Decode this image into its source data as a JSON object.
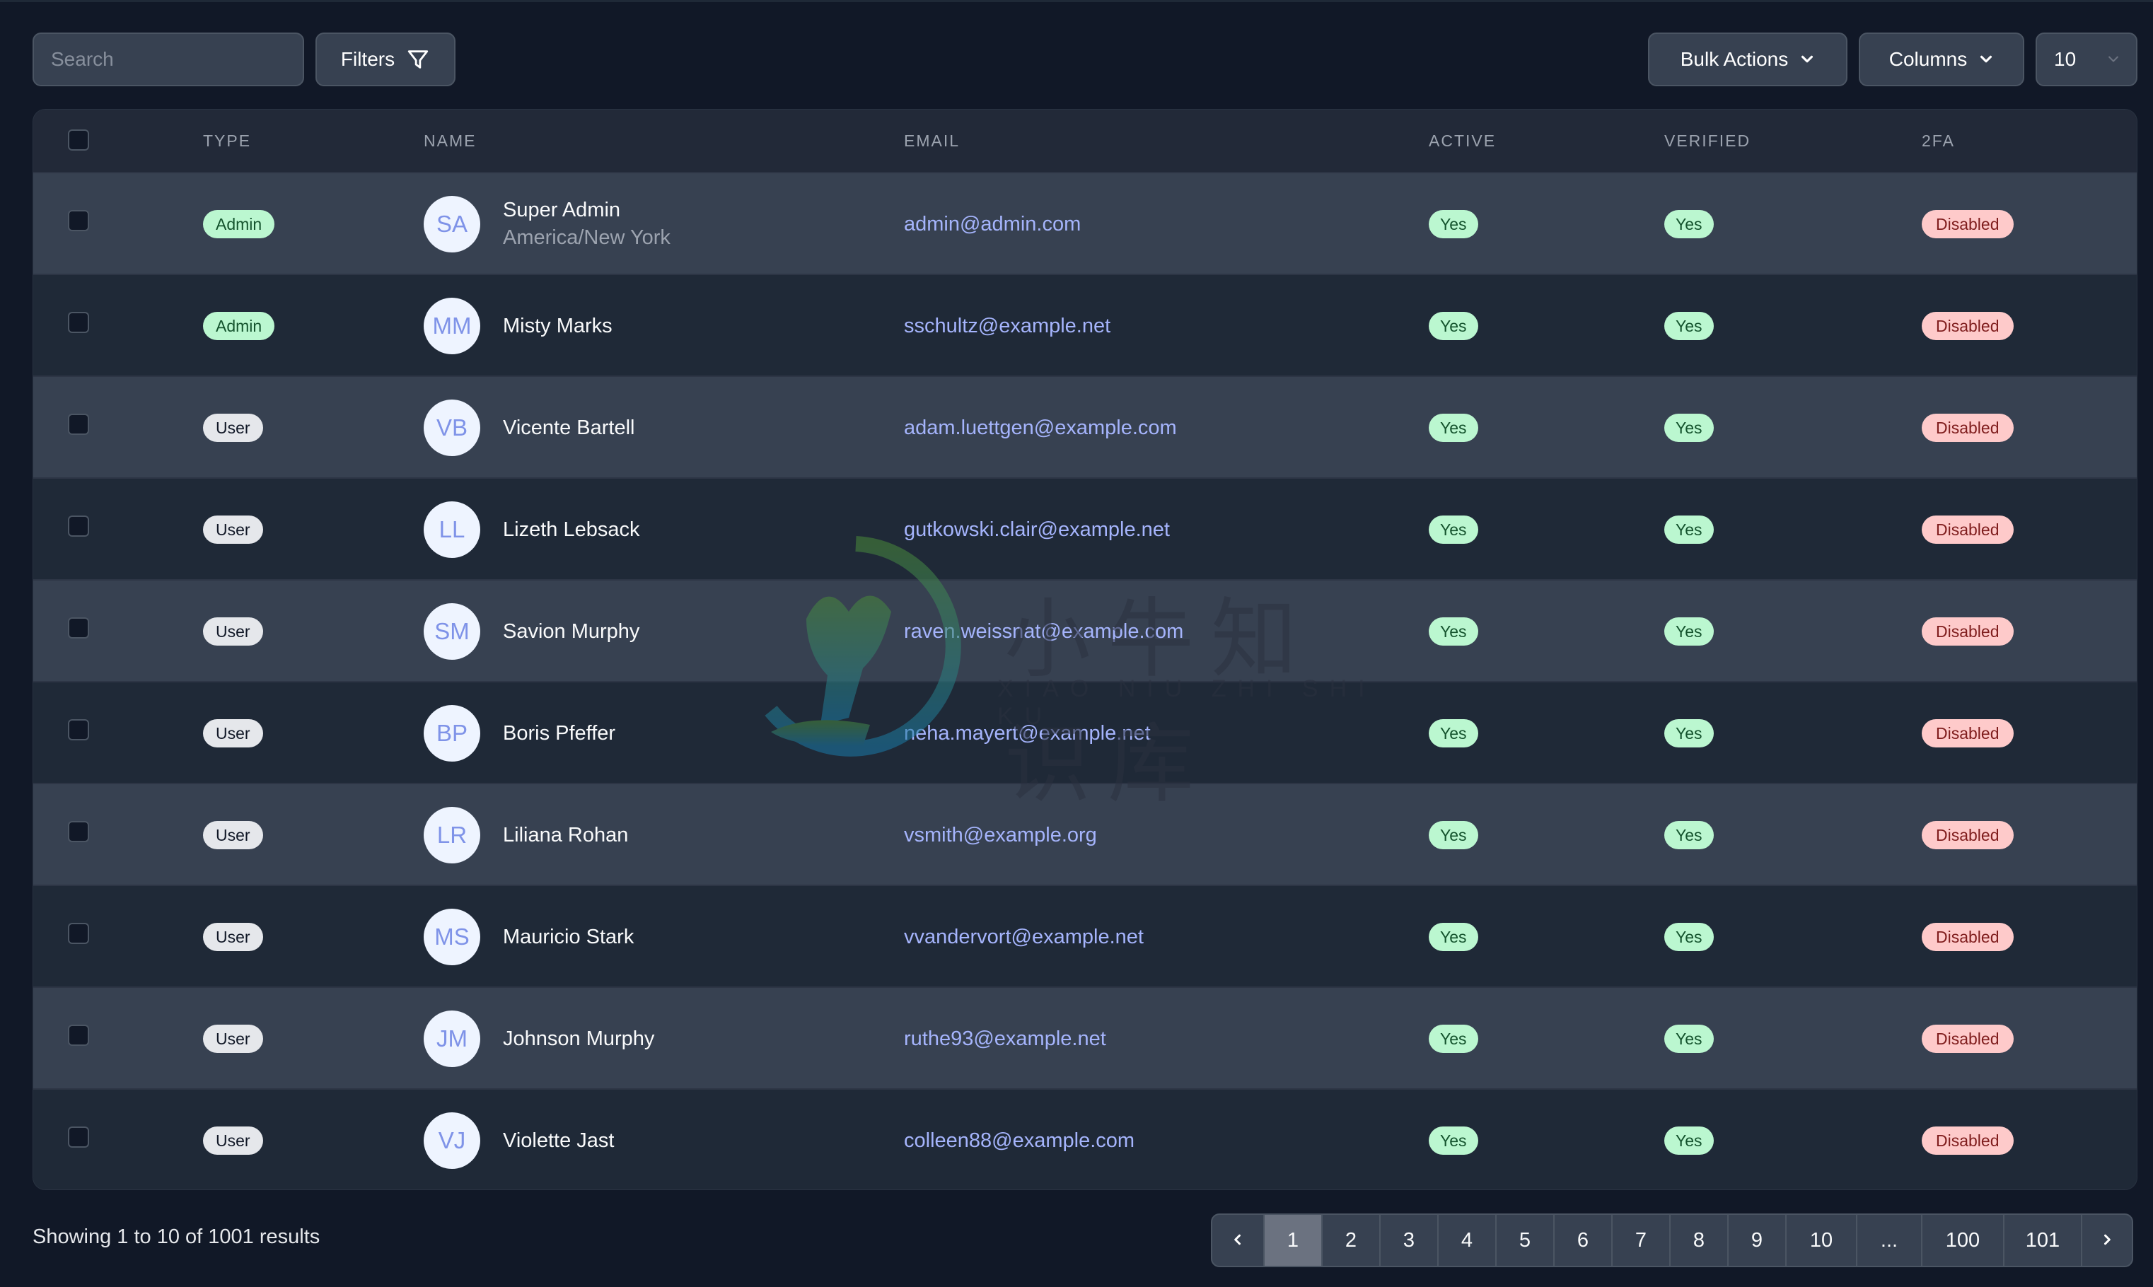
{
  "toolbar": {
    "search_placeholder": "Search",
    "search_value": "",
    "filters_label": "Filters",
    "filters_icon": "funnel-icon",
    "bulk_actions_label": "Bulk Actions",
    "columns_label": "Columns",
    "per_page_value": "10",
    "chevron_icon": "chevron-down-icon"
  },
  "table": {
    "headers": {
      "type": "TYPE",
      "name": "NAME",
      "email": "EMAIL",
      "active": "ACTIVE",
      "verified": "VERIFIED",
      "twofa": "2FA"
    },
    "rows": [
      {
        "type": "Admin",
        "initials": "SA",
        "name": "Super Admin",
        "subtitle": "America/New York",
        "email": "admin@admin.com",
        "active": "Yes",
        "verified": "Yes",
        "twofa": "Disabled"
      },
      {
        "type": "Admin",
        "initials": "MM",
        "name": "Misty Marks",
        "subtitle": "",
        "email": "sschultz@example.net",
        "active": "Yes",
        "verified": "Yes",
        "twofa": "Disabled"
      },
      {
        "type": "User",
        "initials": "VB",
        "name": "Vicente Bartell",
        "subtitle": "",
        "email": "adam.luettgen@example.com",
        "active": "Yes",
        "verified": "Yes",
        "twofa": "Disabled"
      },
      {
        "type": "User",
        "initials": "LL",
        "name": "Lizeth Lebsack",
        "subtitle": "",
        "email": "gutkowski.clair@example.net",
        "active": "Yes",
        "verified": "Yes",
        "twofa": "Disabled"
      },
      {
        "type": "User",
        "initials": "SM",
        "name": "Savion Murphy",
        "subtitle": "",
        "email": "raven.weissnat@example.com",
        "active": "Yes",
        "verified": "Yes",
        "twofa": "Disabled"
      },
      {
        "type": "User",
        "initials": "BP",
        "name": "Boris Pfeffer",
        "subtitle": "",
        "email": "neha.mayert@example.net",
        "active": "Yes",
        "verified": "Yes",
        "twofa": "Disabled"
      },
      {
        "type": "User",
        "initials": "LR",
        "name": "Liliana Rohan",
        "subtitle": "",
        "email": "vsmith@example.org",
        "active": "Yes",
        "verified": "Yes",
        "twofa": "Disabled"
      },
      {
        "type": "User",
        "initials": "MS",
        "name": "Mauricio Stark",
        "subtitle": "",
        "email": "vvandervort@example.net",
        "active": "Yes",
        "verified": "Yes",
        "twofa": "Disabled"
      },
      {
        "type": "User",
        "initials": "JM",
        "name": "Johnson Murphy",
        "subtitle": "",
        "email": "ruthe93@example.net",
        "active": "Yes",
        "verified": "Yes",
        "twofa": "Disabled"
      },
      {
        "type": "User",
        "initials": "VJ",
        "name": "Violette Jast",
        "subtitle": "",
        "email": "colleen88@example.com",
        "active": "Yes",
        "verified": "Yes",
        "twofa": "Disabled"
      }
    ]
  },
  "footer": {
    "results_text": "Showing 1 to 10 of 1001 results",
    "pagination": {
      "prev_icon": "chevron-left-icon",
      "next_icon": "chevron-right-icon",
      "current_page": "1",
      "pages": [
        "1",
        "2",
        "3",
        "4",
        "5",
        "6",
        "7",
        "8",
        "9",
        "10",
        "...",
        "100",
        "101"
      ]
    }
  },
  "watermark": {
    "text_cn": "小牛知识库",
    "text_en": "XIAO NIU ZHI SHI KU"
  },
  "colors": {
    "background": "#111827",
    "row_odd": "#374151",
    "row_even": "#1f2937",
    "email_link": "#a5b4fc",
    "badge_green_bg": "#bbf7d0",
    "badge_green_text": "#14532d",
    "badge_red_bg": "#fecaca",
    "badge_red_text": "#7f1d1d",
    "badge_user_bg": "#e5e7eb",
    "avatar_bg": "#eef4ff",
    "avatar_text": "#7f93e8",
    "active_page_bg": "#6b7280"
  }
}
